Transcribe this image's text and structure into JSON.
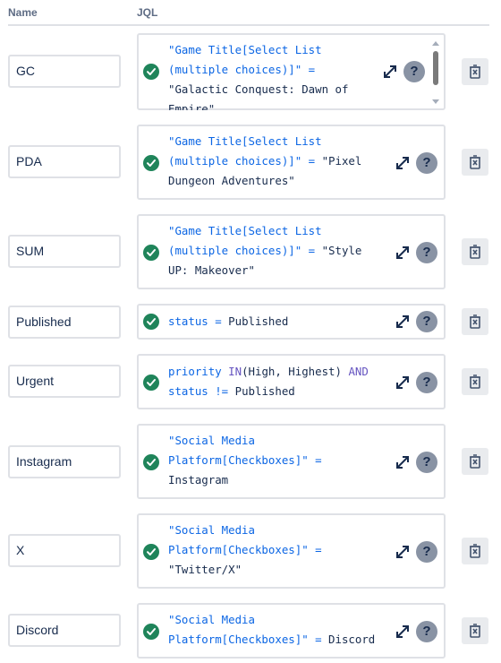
{
  "header": {
    "name_col": "Name",
    "jql_col": "JQL"
  },
  "rows": [
    {
      "name": "GC",
      "jql_line1": "\"Game Title[Select List",
      "jql_line2": "(multiple choices)]\" =",
      "jql_line3": "\"Galactic Conquest: Dawn of",
      "jql_line4": "Empire\""
    },
    {
      "name": "PDA",
      "jql_line1": "\"Game Title[Select List",
      "jql_line2a": "(multiple choices)]\" = ",
      "jql_line2b": "\"Pixel",
      "jql_line3": "Dungeon Adventures\""
    },
    {
      "name": "SUM",
      "jql_line1": "\"Game Title[Select List",
      "jql_line2a": "(multiple choices)]\" = ",
      "jql_line2b": "\"Style",
      "jql_line3": "UP: Makeover\""
    },
    {
      "name": "Published",
      "jql_field": "status",
      "jql_op": " = ",
      "jql_value": "Published"
    },
    {
      "name": "Urgent",
      "jql_field": "priority",
      "jql_in": " IN",
      "jql_paren": "(High, Highest) ",
      "jql_and": "AND",
      "jql_field2": "status",
      "jql_op2": " != ",
      "jql_value2": "Published"
    },
    {
      "name": "Instagram",
      "jql_line1": "\"Social Media",
      "jql_line2": "Platform[Checkboxes]\" =",
      "jql_line3": "Instagram"
    },
    {
      "name": "X",
      "jql_line1": "\"Social Media",
      "jql_line2": "Platform[Checkboxes]\" =",
      "jql_line3": "\"Twitter/X\""
    },
    {
      "name": "Discord",
      "jql_line1": "\"Social Media",
      "jql_line2a": "Platform[Checkboxes]\" = ",
      "jql_line2b": "Discord"
    }
  ],
  "icons": {
    "valid": "check-circle-icon",
    "expand": "expand-arrows-icon",
    "help": "question-icon",
    "delete": "trash-icon"
  },
  "help_glyph": "?",
  "colors": {
    "check": "#1f845a",
    "string": "#0c66e4",
    "keyword": "#6554c0",
    "help_bg": "#8993a4",
    "delete_bg": "#e9ebee",
    "border": "#dfe1e6"
  }
}
